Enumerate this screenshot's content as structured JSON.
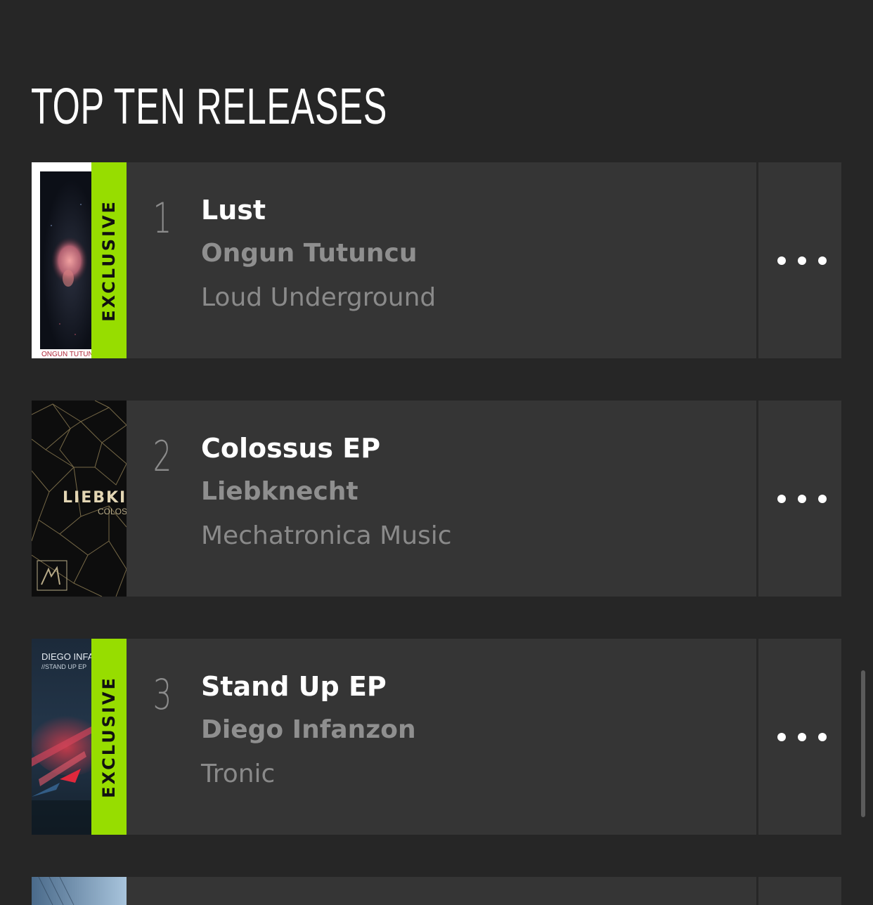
{
  "section": {
    "title": "TOP TEN RELEASES"
  },
  "releases": [
    {
      "rank": "1",
      "title": "Lust",
      "artist": "Ongun Tutuncu",
      "label": "Loud Underground",
      "exclusive": "EXCLUSIVE",
      "artwork_text": "ONGUN TUTUNCU : L"
    },
    {
      "rank": "2",
      "title": "Colossus EP",
      "artist": "Liebknecht",
      "label": "Mechatronica Music",
      "artwork_text": "LIEBKI",
      "artwork_subtext": "COLOS"
    },
    {
      "rank": "3",
      "title": "Stand Up EP",
      "artist": "Diego Infanzon",
      "label": "Tronic",
      "exclusive": "EXCLUSIVE",
      "artwork_text": "DIEGO INFAN",
      "artwork_subtext": "//STAND UP EP"
    }
  ],
  "colors": {
    "background": "#262626",
    "row_background": "#353535",
    "exclusive_badge": "#97dd00",
    "title_text": "#ffffff",
    "secondary_text": "#8f8f8f"
  },
  "icons": {
    "more_options": "more-horizontal-icon"
  }
}
